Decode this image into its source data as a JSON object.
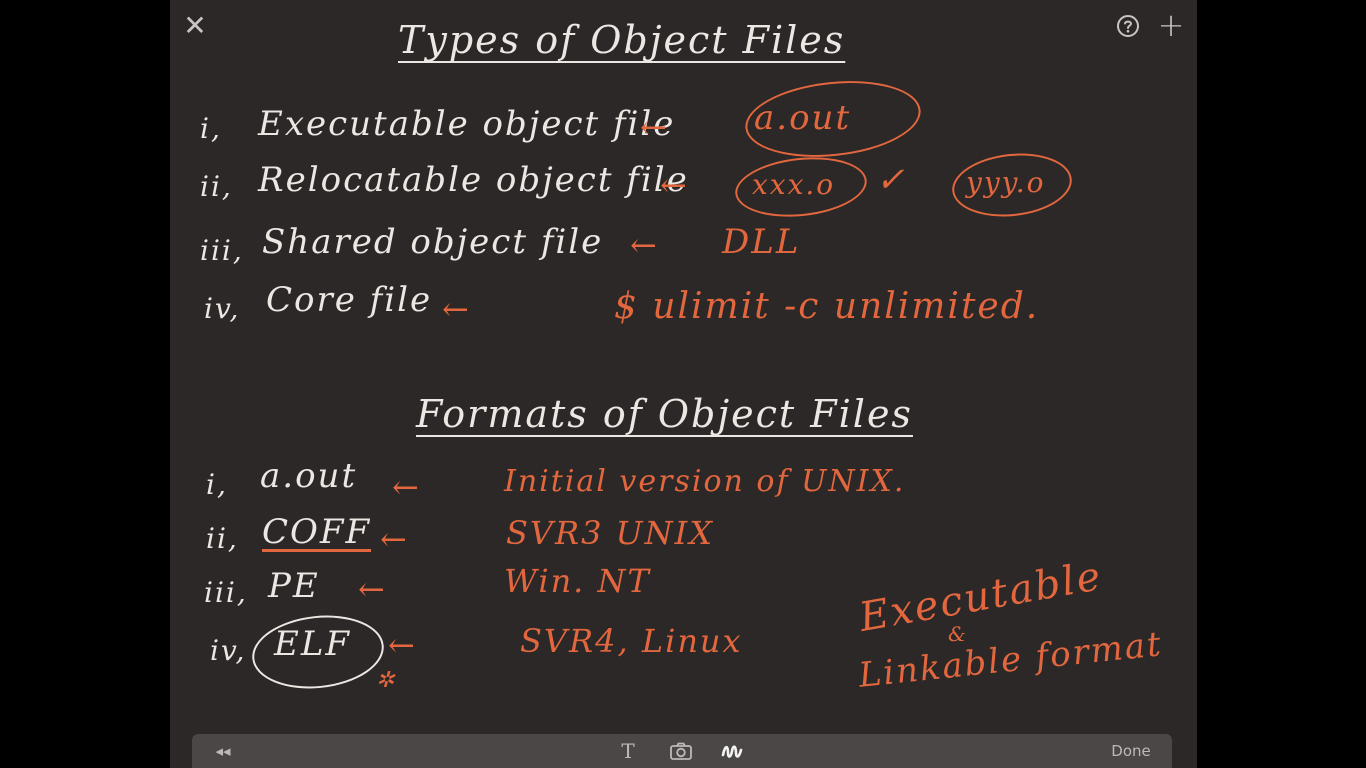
{
  "controls": {
    "close_glyph": "✕",
    "plus_glyph": "+"
  },
  "section1": {
    "title": "Types of Object Files",
    "items": [
      {
        "num": "i,",
        "label": "Executable object file",
        "arrow": "←",
        "note": "a.out"
      },
      {
        "num": "ii,",
        "label": "Relocatable object file",
        "arrow": "←",
        "note": "xxx.o",
        "note_check": "✓",
        "note2": "yyy.o"
      },
      {
        "num": "iii,",
        "label": "Shared object file",
        "arrow": "←",
        "note": "DLL"
      },
      {
        "num": "iv,",
        "label": "Core file",
        "arrow": "←",
        "note": "$ ulimit -c unlimited."
      }
    ]
  },
  "section2": {
    "title": "Formats of Object Files",
    "items": [
      {
        "num": "i,",
        "label": "a.out",
        "arrow": "←",
        "note": "Initial version of UNIX."
      },
      {
        "num": "ii,",
        "label": "COFF",
        "arrow": "←",
        "note": "SVR3 UNIX"
      },
      {
        "num": "iii,",
        "label": "PE",
        "arrow": "←",
        "note": "Win. NT"
      },
      {
        "num": "iv,",
        "label": "ELF",
        "arrow": "←",
        "note": "SVR4, Linux"
      }
    ],
    "star": "✲",
    "side_note": {
      "line1": "Executable",
      "amp": "&",
      "line2": "Linkable format"
    }
  },
  "toolbar": {
    "rewind_glyph": "◂◂",
    "text_glyph": "T",
    "done_label": "Done"
  }
}
